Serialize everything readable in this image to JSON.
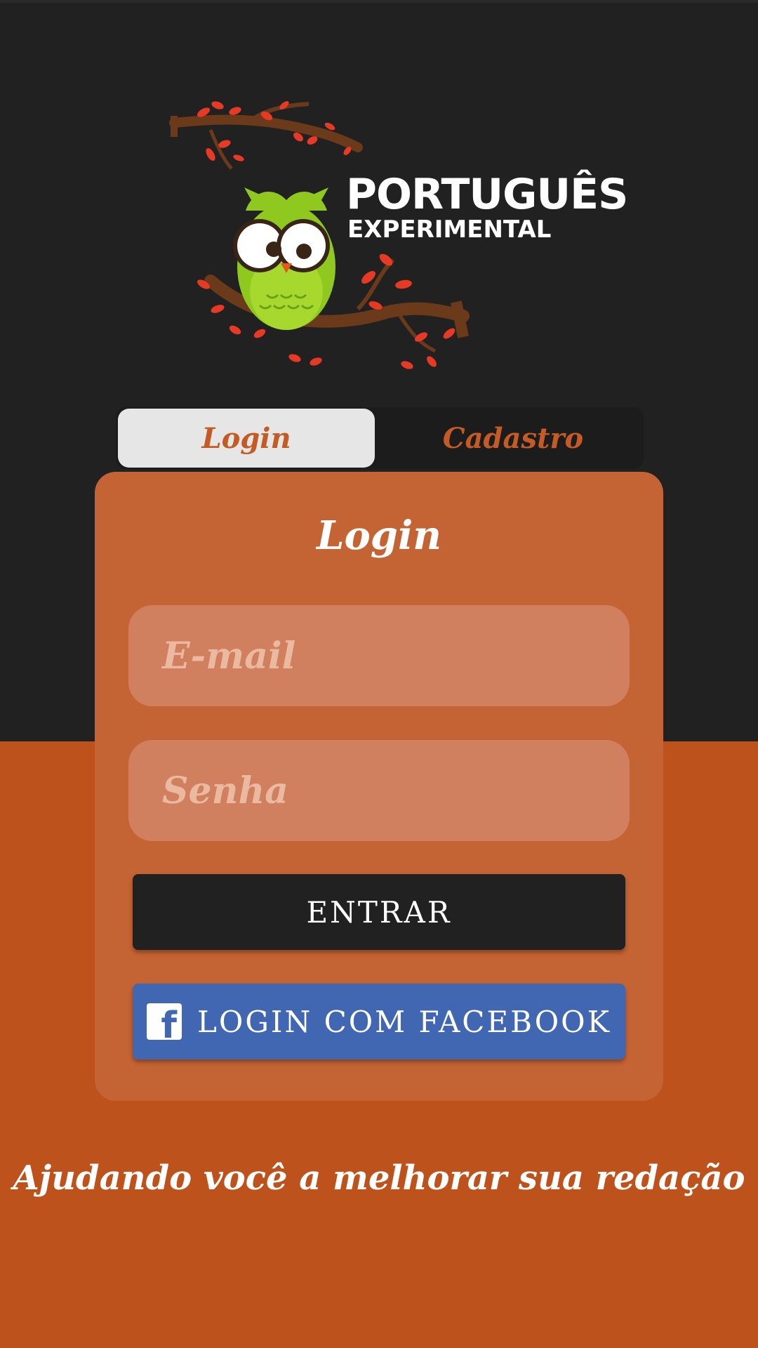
{
  "brand": {
    "title_line1": "PORTUGUÊS",
    "title_line2": "EXPERIMENTAL"
  },
  "tabs": [
    {
      "label": "Login",
      "selected": true
    },
    {
      "label": "Cadastro",
      "selected": false
    }
  ],
  "card": {
    "title": "Login",
    "email_placeholder": "E-mail",
    "password_placeholder": "Senha",
    "submit_label": "ENTRAR",
    "facebook_label": "LOGIN COM FACEBOOK"
  },
  "tagline": "Ajudando você a melhorar sua redação",
  "colors": {
    "background_top": "#212121",
    "background_bottom": "#bd521c",
    "card": "#c46334",
    "accent": "#c45a24",
    "facebook": "#4267b2"
  },
  "icons": [
    "owl-logo-icon",
    "facebook-icon"
  ]
}
